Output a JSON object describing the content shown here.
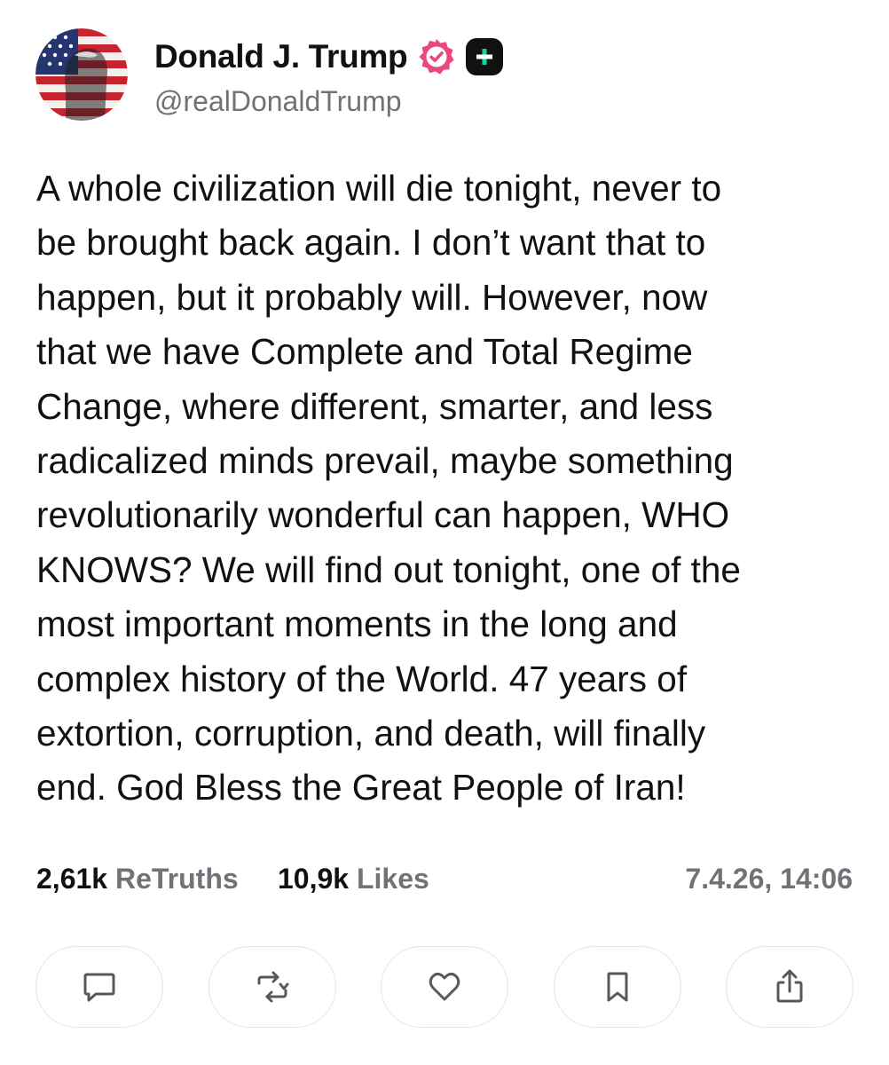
{
  "author": {
    "display_name": "Donald J. Trump",
    "handle": "@realDonaldTrump",
    "avatar_icon": "flag-portrait-avatar",
    "verified_badge_icon": "verified-badge-icon",
    "verified_color": "#e8497a",
    "plus_badge_icon": "truth-plus-icon",
    "plus_badge_color": "#17d1a5"
  },
  "post": {
    "text": "A whole civilization will die tonight, never to\nbe brought back again. I don’t want that to\nhappen, but it probably will. However, now\nthat we have Complete and Total Regime\nChange, where different, smarter, and less\nradicalized minds prevail, maybe something\nrevolutionarily wonderful can happen, WHO\nKNOWS? We will find out tonight, one of the\nmost important moments in the long and\ncomplex history of the World. 47 years of\nextortion, corruption, and death, will finally\nend. God Bless the Great People of Iran!"
  },
  "stats": {
    "retruths_count": "2,61k",
    "retruths_label": "ReTruths",
    "likes_count": "10,9k",
    "likes_label": "Likes",
    "timestamp": "7.4.26, 14:06"
  },
  "actions": [
    {
      "name": "reply",
      "icon": "comment-icon"
    },
    {
      "name": "retruth",
      "icon": "repost-icon"
    },
    {
      "name": "like",
      "icon": "heart-icon"
    },
    {
      "name": "bookmark",
      "icon": "bookmark-icon"
    },
    {
      "name": "share",
      "icon": "share-icon"
    }
  ]
}
